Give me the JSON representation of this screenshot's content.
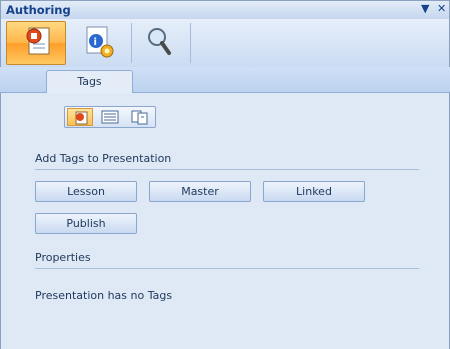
{
  "window": {
    "title": "Authoring",
    "menu_glyph": "▼",
    "close_glyph": "✕"
  },
  "toolbar": {
    "buttons": [
      {
        "icon": "presentation-icon",
        "selected": true
      },
      {
        "icon": "info-settings-icon",
        "selected": false
      },
      {
        "icon": "magnifier-icon",
        "selected": false
      }
    ]
  },
  "tabs": [
    {
      "label": "Tags",
      "selected": true
    }
  ],
  "view_switcher": [
    "presentation-view-icon",
    "slide-list-view-icon",
    "linked-view-icon"
  ],
  "add_tags": {
    "heading": "Add Tags to Presentation",
    "buttons": [
      "Lesson",
      "Master",
      "Linked",
      "Publish"
    ]
  },
  "properties": {
    "heading": "Properties",
    "message": "Presentation has no Tags"
  },
  "colors": {
    "accent": "#15428b",
    "panel_bg": "#dfe8f5",
    "selected_orange": "#ffb54a"
  }
}
